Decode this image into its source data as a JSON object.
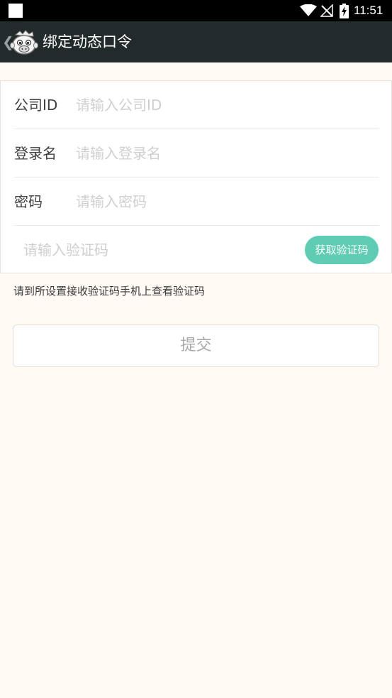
{
  "status_bar": {
    "time": "11:51",
    "icons": [
      "notification-box-icon",
      "wifi-icon",
      "no-signal-icon",
      "battery-charging-icon"
    ]
  },
  "app_bar": {
    "back_glyph": "❮",
    "title": "绑定动态口令",
    "logo_icon": "cartoon-mascot-logo",
    "background": "#222a2b"
  },
  "form": {
    "company_id": {
      "label": "公司ID",
      "placeholder": "请输入公司ID",
      "value": ""
    },
    "login_name": {
      "label": "登录名",
      "placeholder": "请输入登录名",
      "value": ""
    },
    "password": {
      "label": "密码",
      "placeholder": "请输入密码",
      "value": ""
    },
    "verify_code": {
      "placeholder": "请输入验证码",
      "value": "",
      "button_label": "获取验证码"
    }
  },
  "hint": "请到所设置接收验证码手机上查看验证码",
  "submit_label": "提交",
  "colors": {
    "accent": "#5fcdb4",
    "page_background": "#fffaf4",
    "placeholder": "#cfcfcf"
  }
}
